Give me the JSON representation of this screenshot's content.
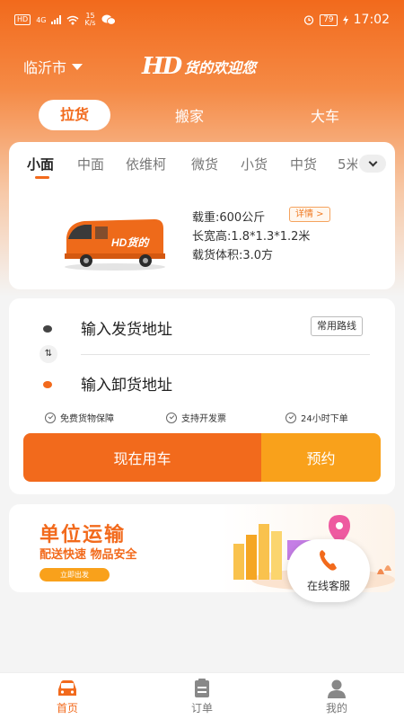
{
  "status_bar": {
    "network_badge": "HD",
    "network_type": "4G",
    "speed_value": "15",
    "speed_unit": "K/s",
    "battery": "79",
    "time": "17:02"
  },
  "header": {
    "city": "临沂市",
    "logo_mark": "HD",
    "logo_text": "货的欢迎您"
  },
  "service_tabs": [
    {
      "label": "拉货",
      "active": true
    },
    {
      "label": "搬家",
      "active": false
    },
    {
      "label": "大车",
      "active": false
    }
  ],
  "vehicle_tabs": [
    {
      "label": "小面",
      "active": true
    },
    {
      "label": "中面",
      "active": false
    },
    {
      "label": "依维柯",
      "active": false
    },
    {
      "label": "微货",
      "active": false
    },
    {
      "label": "小货",
      "active": false
    },
    {
      "label": "中货",
      "active": false
    },
    {
      "label": "5米",
      "active": false
    }
  ],
  "vehicle": {
    "van_logo": "HD货的",
    "load": "载重:600公斤",
    "dimensions": "长宽高:1.8*1.3*1.2米",
    "volume": "载货体积:3.0方",
    "detail_label": "详情 >"
  },
  "address": {
    "from_placeholder": "输入发货地址",
    "to_placeholder": "输入卸货地址",
    "common_routes_label": "常用路线",
    "swap_symbol": "⇅"
  },
  "guarantees": [
    {
      "label": "免费货物保障"
    },
    {
      "label": "支持开发票"
    },
    {
      "label": "24小时下单"
    }
  ],
  "actions": {
    "use_now": "现在用车",
    "book": "预约"
  },
  "banner": {
    "title": "单位运输",
    "subtitle": "配送快速 物品安全",
    "button": "立即出发"
  },
  "customer_service": {
    "label": "在线客服"
  },
  "bottom_nav": [
    {
      "label": "首页",
      "active": true,
      "icon": "car-icon"
    },
    {
      "label": "订单",
      "active": false,
      "icon": "clipboard-icon"
    },
    {
      "label": "我的",
      "active": false,
      "icon": "user-icon"
    }
  ],
  "colors": {
    "brand_orange": "#f26a1c",
    "booking_yellow": "#f9a11b"
  }
}
